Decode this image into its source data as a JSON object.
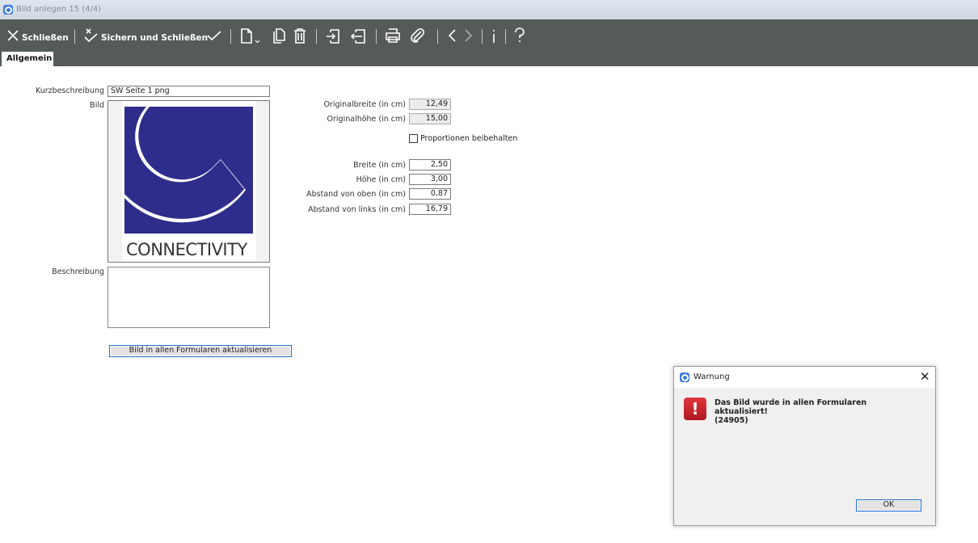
{
  "window": {
    "title": "Bild anlegen 15 (4/4)"
  },
  "toolbar": {
    "close_label": "Schließen",
    "save_close_label": "Sichern und Schließen"
  },
  "tabs": [
    {
      "label": "Allgemein",
      "active": true
    }
  ],
  "form": {
    "short_desc_label": "Kurzbeschreibung",
    "short_desc_value": "SW Seite 1 png",
    "image_label": "Bild",
    "logo_text": "CONNECTIVITY",
    "description_label": "Beschreibung",
    "description_value": "",
    "update_button": "Bild in allen Formularen aktualisieren",
    "orig_width_label": "Originalbreite (in cm)",
    "orig_width": "12,49",
    "orig_height_label": "Originalhöhe (in cm)",
    "orig_height": "15,00",
    "keep_proportions_label": "Proportionen beibehalten",
    "keep_proportions": false,
    "width_label": "Breite (in cm)",
    "width": "2,50",
    "height_label": "Höhe (in cm)",
    "height": "3,00",
    "top_label": "Abstand von oben (in cm)",
    "top": "0,87",
    "left_label": "Abstand von links (in cm)",
    "left": "16,79"
  },
  "dialog": {
    "title": "Warnung",
    "message_line1": "Das Bild wurde in allen Formularen",
    "message_line2": "aktualisiert!",
    "message_code": "(24905)",
    "ok": "OK"
  },
  "colors": {
    "toolbar": "#555b59",
    "logo": "#2e2d8c",
    "error": "#c8232a"
  }
}
